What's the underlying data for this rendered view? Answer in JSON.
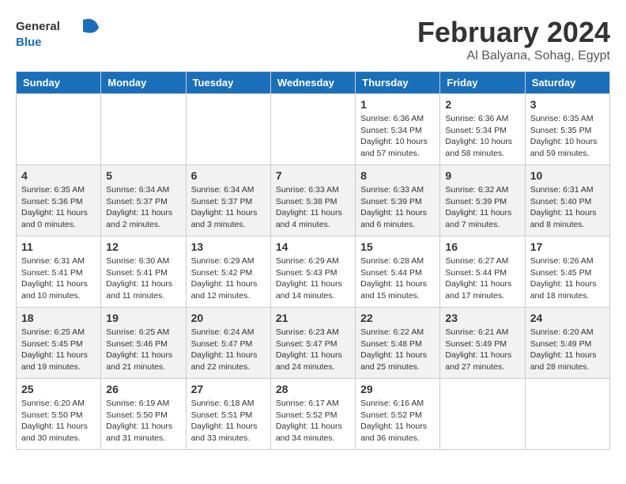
{
  "header": {
    "logo_general": "General",
    "logo_blue": "Blue",
    "month_title": "February 2024",
    "location": "Al Balyana, Sohag, Egypt"
  },
  "weekdays": [
    "Sunday",
    "Monday",
    "Tuesday",
    "Wednesday",
    "Thursday",
    "Friday",
    "Saturday"
  ],
  "weeks": [
    [
      {
        "day": "",
        "sunrise": "",
        "sunset": "",
        "daylight": ""
      },
      {
        "day": "",
        "sunrise": "",
        "sunset": "",
        "daylight": ""
      },
      {
        "day": "",
        "sunrise": "",
        "sunset": "",
        "daylight": ""
      },
      {
        "day": "",
        "sunrise": "",
        "sunset": "",
        "daylight": ""
      },
      {
        "day": "1",
        "sunrise": "Sunrise: 6:36 AM",
        "sunset": "Sunset: 5:34 PM",
        "daylight": "Daylight: 10 hours and 57 minutes."
      },
      {
        "day": "2",
        "sunrise": "Sunrise: 6:36 AM",
        "sunset": "Sunset: 5:34 PM",
        "daylight": "Daylight: 10 hours and 58 minutes."
      },
      {
        "day": "3",
        "sunrise": "Sunrise: 6:35 AM",
        "sunset": "Sunset: 5:35 PM",
        "daylight": "Daylight: 10 hours and 59 minutes."
      }
    ],
    [
      {
        "day": "4",
        "sunrise": "Sunrise: 6:35 AM",
        "sunset": "Sunset: 5:36 PM",
        "daylight": "Daylight: 11 hours and 0 minutes."
      },
      {
        "day": "5",
        "sunrise": "Sunrise: 6:34 AM",
        "sunset": "Sunset: 5:37 PM",
        "daylight": "Daylight: 11 hours and 2 minutes."
      },
      {
        "day": "6",
        "sunrise": "Sunrise: 6:34 AM",
        "sunset": "Sunset: 5:37 PM",
        "daylight": "Daylight: 11 hours and 3 minutes."
      },
      {
        "day": "7",
        "sunrise": "Sunrise: 6:33 AM",
        "sunset": "Sunset: 5:38 PM",
        "daylight": "Daylight: 11 hours and 4 minutes."
      },
      {
        "day": "8",
        "sunrise": "Sunrise: 6:33 AM",
        "sunset": "Sunset: 5:39 PM",
        "daylight": "Daylight: 11 hours and 6 minutes."
      },
      {
        "day": "9",
        "sunrise": "Sunrise: 6:32 AM",
        "sunset": "Sunset: 5:39 PM",
        "daylight": "Daylight: 11 hours and 7 minutes."
      },
      {
        "day": "10",
        "sunrise": "Sunrise: 6:31 AM",
        "sunset": "Sunset: 5:40 PM",
        "daylight": "Daylight: 11 hours and 8 minutes."
      }
    ],
    [
      {
        "day": "11",
        "sunrise": "Sunrise: 6:31 AM",
        "sunset": "Sunset: 5:41 PM",
        "daylight": "Daylight: 11 hours and 10 minutes."
      },
      {
        "day": "12",
        "sunrise": "Sunrise: 6:30 AM",
        "sunset": "Sunset: 5:41 PM",
        "daylight": "Daylight: 11 hours and 11 minutes."
      },
      {
        "day": "13",
        "sunrise": "Sunrise: 6:29 AM",
        "sunset": "Sunset: 5:42 PM",
        "daylight": "Daylight: 11 hours and 12 minutes."
      },
      {
        "day": "14",
        "sunrise": "Sunrise: 6:29 AM",
        "sunset": "Sunset: 5:43 PM",
        "daylight": "Daylight: 11 hours and 14 minutes."
      },
      {
        "day": "15",
        "sunrise": "Sunrise: 6:28 AM",
        "sunset": "Sunset: 5:44 PM",
        "daylight": "Daylight: 11 hours and 15 minutes."
      },
      {
        "day": "16",
        "sunrise": "Sunrise: 6:27 AM",
        "sunset": "Sunset: 5:44 PM",
        "daylight": "Daylight: 11 hours and 17 minutes."
      },
      {
        "day": "17",
        "sunrise": "Sunrise: 6:26 AM",
        "sunset": "Sunset: 5:45 PM",
        "daylight": "Daylight: 11 hours and 18 minutes."
      }
    ],
    [
      {
        "day": "18",
        "sunrise": "Sunrise: 6:25 AM",
        "sunset": "Sunset: 5:45 PM",
        "daylight": "Daylight: 11 hours and 19 minutes."
      },
      {
        "day": "19",
        "sunrise": "Sunrise: 6:25 AM",
        "sunset": "Sunset: 5:46 PM",
        "daylight": "Daylight: 11 hours and 21 minutes."
      },
      {
        "day": "20",
        "sunrise": "Sunrise: 6:24 AM",
        "sunset": "Sunset: 5:47 PM",
        "daylight": "Daylight: 11 hours and 22 minutes."
      },
      {
        "day": "21",
        "sunrise": "Sunrise: 6:23 AM",
        "sunset": "Sunset: 5:47 PM",
        "daylight": "Daylight: 11 hours and 24 minutes."
      },
      {
        "day": "22",
        "sunrise": "Sunrise: 6:22 AM",
        "sunset": "Sunset: 5:48 PM",
        "daylight": "Daylight: 11 hours and 25 minutes."
      },
      {
        "day": "23",
        "sunrise": "Sunrise: 6:21 AM",
        "sunset": "Sunset: 5:49 PM",
        "daylight": "Daylight: 11 hours and 27 minutes."
      },
      {
        "day": "24",
        "sunrise": "Sunrise: 6:20 AM",
        "sunset": "Sunset: 5:49 PM",
        "daylight": "Daylight: 11 hours and 28 minutes."
      }
    ],
    [
      {
        "day": "25",
        "sunrise": "Sunrise: 6:20 AM",
        "sunset": "Sunset: 5:50 PM",
        "daylight": "Daylight: 11 hours and 30 minutes."
      },
      {
        "day": "26",
        "sunrise": "Sunrise: 6:19 AM",
        "sunset": "Sunset: 5:50 PM",
        "daylight": "Daylight: 11 hours and 31 minutes."
      },
      {
        "day": "27",
        "sunrise": "Sunrise: 6:18 AM",
        "sunset": "Sunset: 5:51 PM",
        "daylight": "Daylight: 11 hours and 33 minutes."
      },
      {
        "day": "28",
        "sunrise": "Sunrise: 6:17 AM",
        "sunset": "Sunset: 5:52 PM",
        "daylight": "Daylight: 11 hours and 34 minutes."
      },
      {
        "day": "29",
        "sunrise": "Sunrise: 6:16 AM",
        "sunset": "Sunset: 5:52 PM",
        "daylight": "Daylight: 11 hours and 36 minutes."
      },
      {
        "day": "",
        "sunrise": "",
        "sunset": "",
        "daylight": ""
      },
      {
        "day": "",
        "sunrise": "",
        "sunset": "",
        "daylight": ""
      }
    ]
  ]
}
